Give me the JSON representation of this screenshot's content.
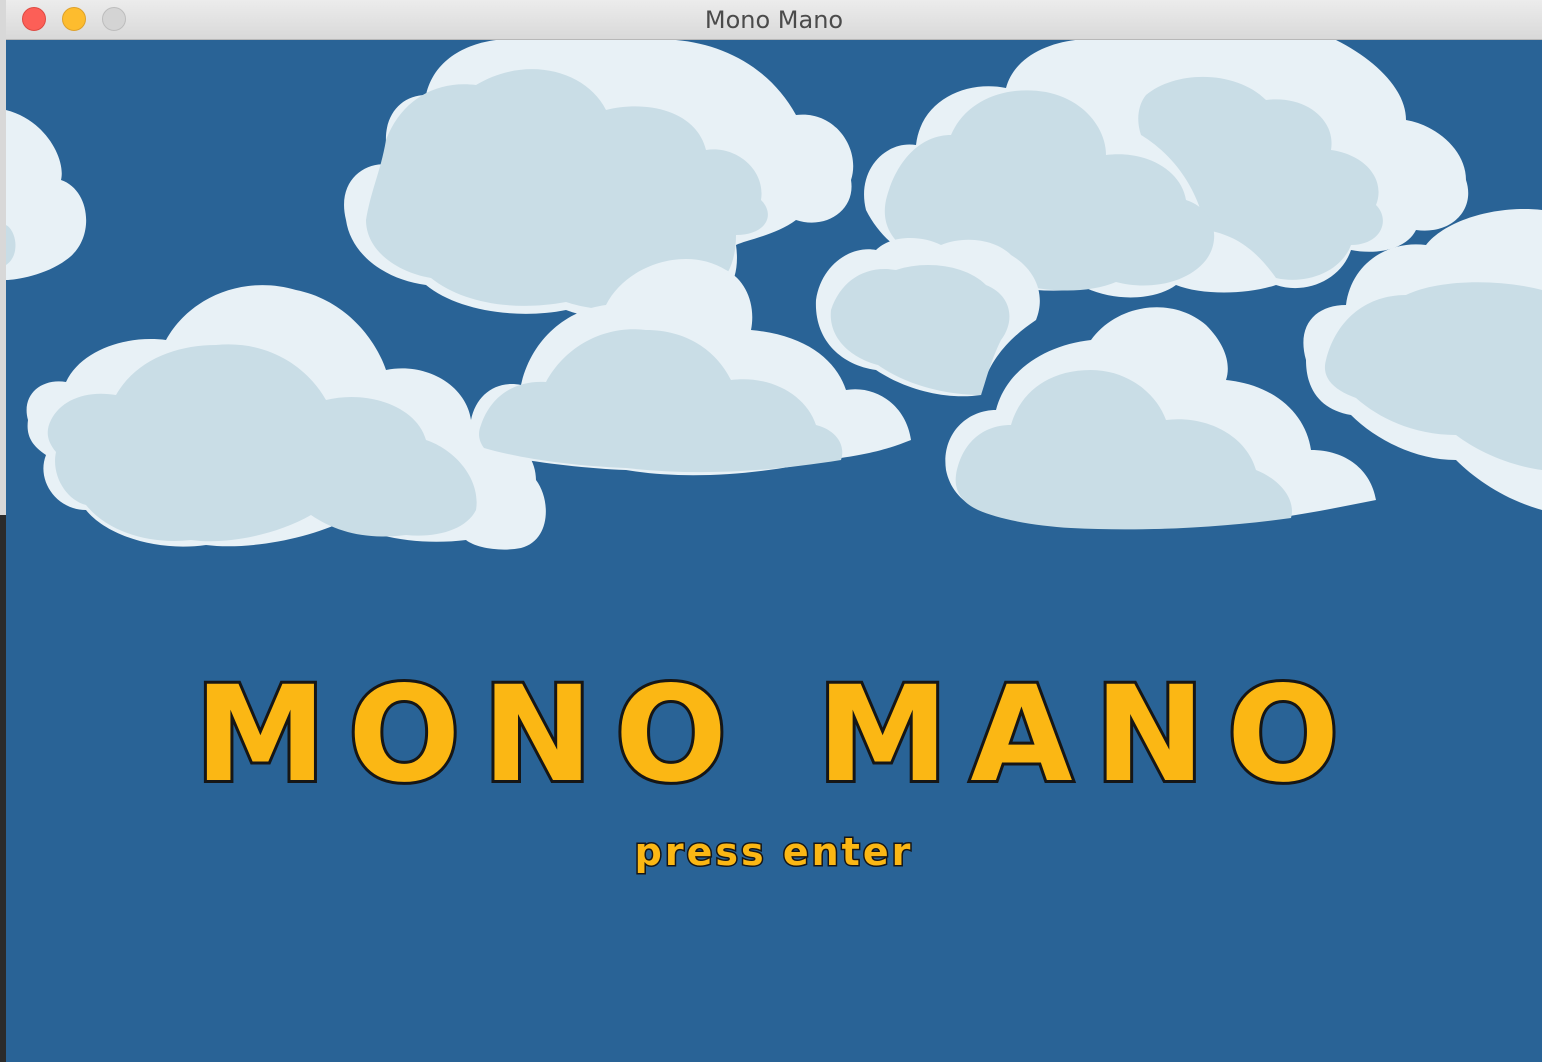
{
  "window": {
    "title": "Mono Mano",
    "controls": [
      "close",
      "minimize",
      "zoom"
    ]
  },
  "game": {
    "logo": "MONO MANO",
    "prompt": "press enter",
    "colors": {
      "sky": "#296396",
      "cloud_light": "#e8f1f6",
      "cloud_shadow": "#c9dde6",
      "logo_fill": "#fbb714",
      "logo_outline": "#161616"
    }
  }
}
